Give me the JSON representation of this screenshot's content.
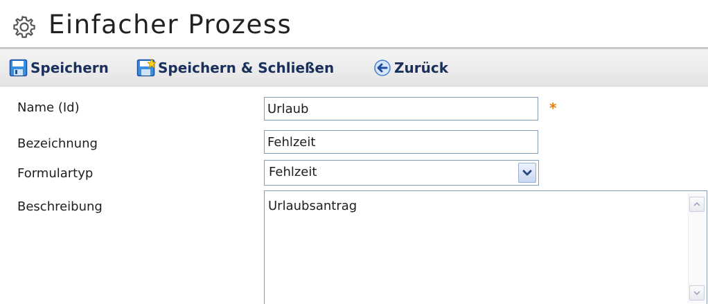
{
  "header": {
    "title": "Einfacher Prozess",
    "icon": "gear-icon"
  },
  "toolbar": {
    "save_label": "Speichern",
    "save_close_label": "Speichern & Schließen",
    "back_label": "Zurück",
    "save_icon": "floppy-disk-icon",
    "save_close_icon": "floppy-disk-star-icon",
    "back_icon": "back-arrow-icon"
  },
  "form": {
    "name_label": "Name (Id)",
    "name_value": "Urlaub",
    "required_marker": "*",
    "bezeichnung_label": "Bezeichnung",
    "bezeichnung_value": "Fehlzeit",
    "formulartyp_label": "Formulartyp",
    "formulartyp_value": "Fehlzeit",
    "beschreibung_label": "Beschreibung",
    "beschreibung_value": "Urlaubsantrag"
  },
  "colors": {
    "toolbar_text": "#1a2f5a",
    "required": "#e07d10",
    "input_border": "#7f9db9"
  }
}
